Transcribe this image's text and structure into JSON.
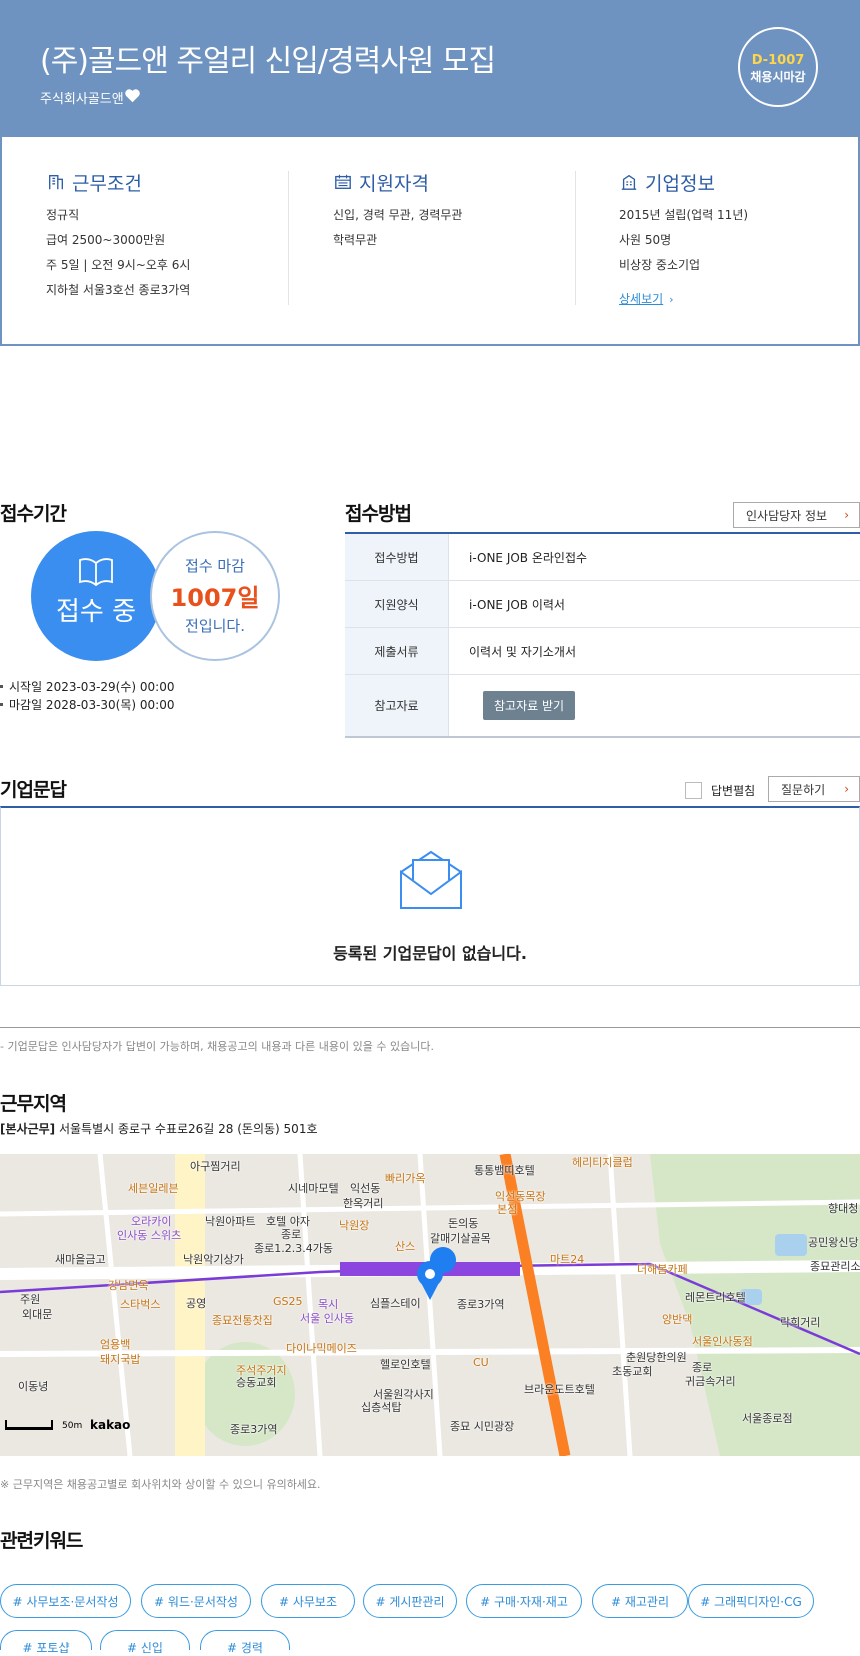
{
  "header": {
    "title": "(주)골드앤 주얼리 신입/경력사원 모집",
    "company": "주식회사골드앤",
    "dday": "D-1007",
    "deadline_label": "채용시마감"
  },
  "summary": {
    "work": {
      "title": "근무조건",
      "items": [
        "정규직",
        "급여 2500~3000만원",
        "주 5일 | 오전 9시~오후 6시",
        "지하철 서울3호선 종로3가역"
      ]
    },
    "qualification": {
      "title": "지원자격",
      "items": [
        "신입, 경력 무관, 경력무관",
        "학력무관"
      ]
    },
    "company": {
      "title": "기업정보",
      "items": [
        "2015년 설립(업력 11년)",
        "사원 50명",
        "비상장 중소기업"
      ],
      "more": "상세보기"
    }
  },
  "period": {
    "title": "접수기간",
    "status": "접수 중",
    "deadline_top": "접수 마감",
    "days": "1007일",
    "deadline_bottom": "전입니다.",
    "start": "시작일 2023-03-29(수) 00:00",
    "end": "마감일 2028-03-30(목) 00:00"
  },
  "method": {
    "title": "접수방법",
    "contact_button": "인사담당자 정보",
    "rows": [
      {
        "key": "접수방법",
        "value": "i-ONE JOB 온라인접수"
      },
      {
        "key": "지원양식",
        "value": "i-ONE JOB 이력서"
      },
      {
        "key": "제출서류",
        "value": "이력서 및 자기소개서"
      },
      {
        "key": "참고자료",
        "value": "참고자료 받기"
      }
    ]
  },
  "qna": {
    "title": "기업문답",
    "expand_label": "답변펼침",
    "ask_button": "질문하기",
    "empty": "등록된 기업문답이 없습니다.",
    "note": "- 기업문답은 인사담당자가 답변이 가능하며, 채용공고의 내용과 다른 내용이 있을 수 있습니다."
  },
  "location": {
    "title": "근무지역",
    "office_tag": "[본사근무]",
    "address": "서울특별시 종로구 수표로26길 28 (돈의동) 501호",
    "note": "※ 근무지역은 채용공고별로 회사위치와 상이할 수 있으니 유의하세요.",
    "map": {
      "scale": "50m",
      "brand": "kakao",
      "labels": [
        "아구찜거리",
        "세븐일레븐",
        "시네마모텔",
        "빠리가옥",
        "통통뱀띠호텔",
        "헤리티지클럽",
        "익선동",
        "한옥거리",
        "익선동목장",
        "본점",
        "향대청",
        "오라카이",
        "인사동 스위츠",
        "낙원아파트",
        "호텔 야자",
        "종로",
        "낙원장",
        "돈의동",
        "갈매기살골목",
        "공민왕신당",
        "새마을금고",
        "낙원악기상가",
        "종로1.2.3.4가동",
        "산스",
        "마트24",
        "더해봄카페",
        "종묘관리소",
        "강남면옥",
        "스타벅스",
        "공영",
        "GS25",
        "목시",
        "서울 인사동",
        "심플스테이",
        "종로3가역",
        "레몬트리호텔",
        "종묘전통찻집",
        "양반댁",
        "락희거리",
        "주원",
        "외대문",
        "엄용백",
        "돼지국밥",
        "다이나믹메이즈",
        "서울인사동점",
        "헬로인호텔",
        "CU",
        "춘원당한의원",
        "초동교회",
        "종로",
        "귀금속거리",
        "이동녕",
        "주석주거지",
        "승동교회",
        "서울원각사지",
        "십층석탑",
        "브라운도트호텔",
        "서울종로점",
        "종로3가역",
        "종묘 시민광장",
        "탑골공원",
        "T모텔"
      ]
    }
  },
  "keywords": {
    "title": "관련키워드",
    "items": [
      "# 사무보조·문서작성",
      "# 워드·문서작성",
      "# 사무보조",
      "# 게시판관리",
      "# 구매·자재·재고",
      "# 재고관리",
      "# 그래픽디자인·CG",
      "# 포토샵",
      "# 신입",
      "# 경력"
    ]
  }
}
